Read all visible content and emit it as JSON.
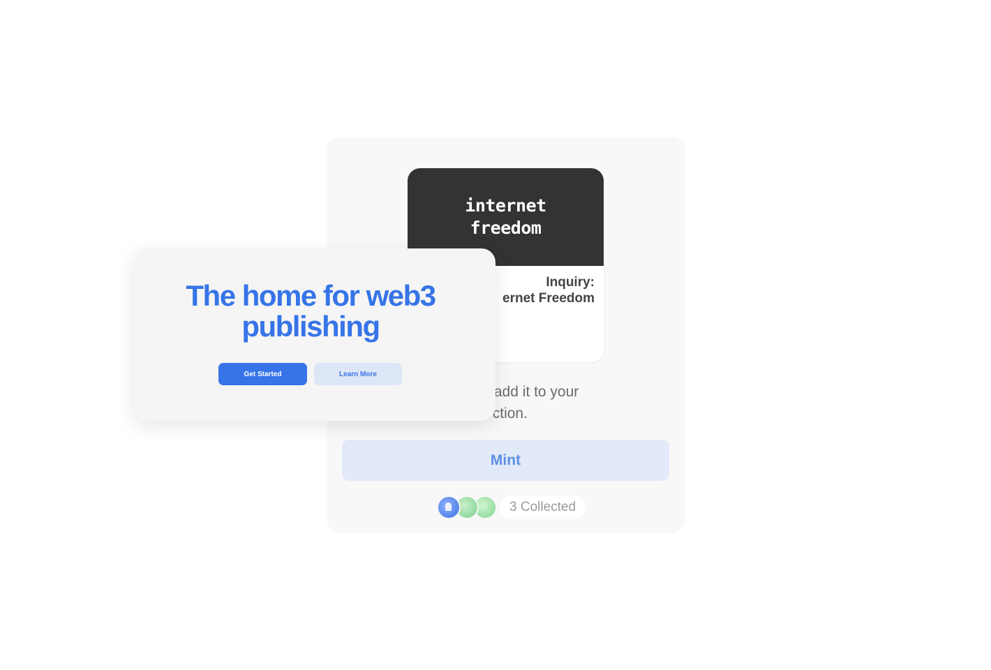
{
  "nft_card": {
    "image_line1": "internet",
    "image_line2": "freedom",
    "title_line1": "Inquiry:",
    "title_line2": "ernet Freedom"
  },
  "mint_panel": {
    "description_line1": "n NFT to add it to your",
    "description_line2": "ection.",
    "mint_label": "Mint",
    "collected_label": "3 Collected"
  },
  "hero": {
    "title_line1": "The home for web3",
    "title_line2": "publishing",
    "get_started_label": "Get Started",
    "learn_more_label": "Learn More"
  },
  "colors": {
    "brand_blue": "#3674e8",
    "mint_bg": "#e2e9f8",
    "nft_dark": "#333333"
  }
}
